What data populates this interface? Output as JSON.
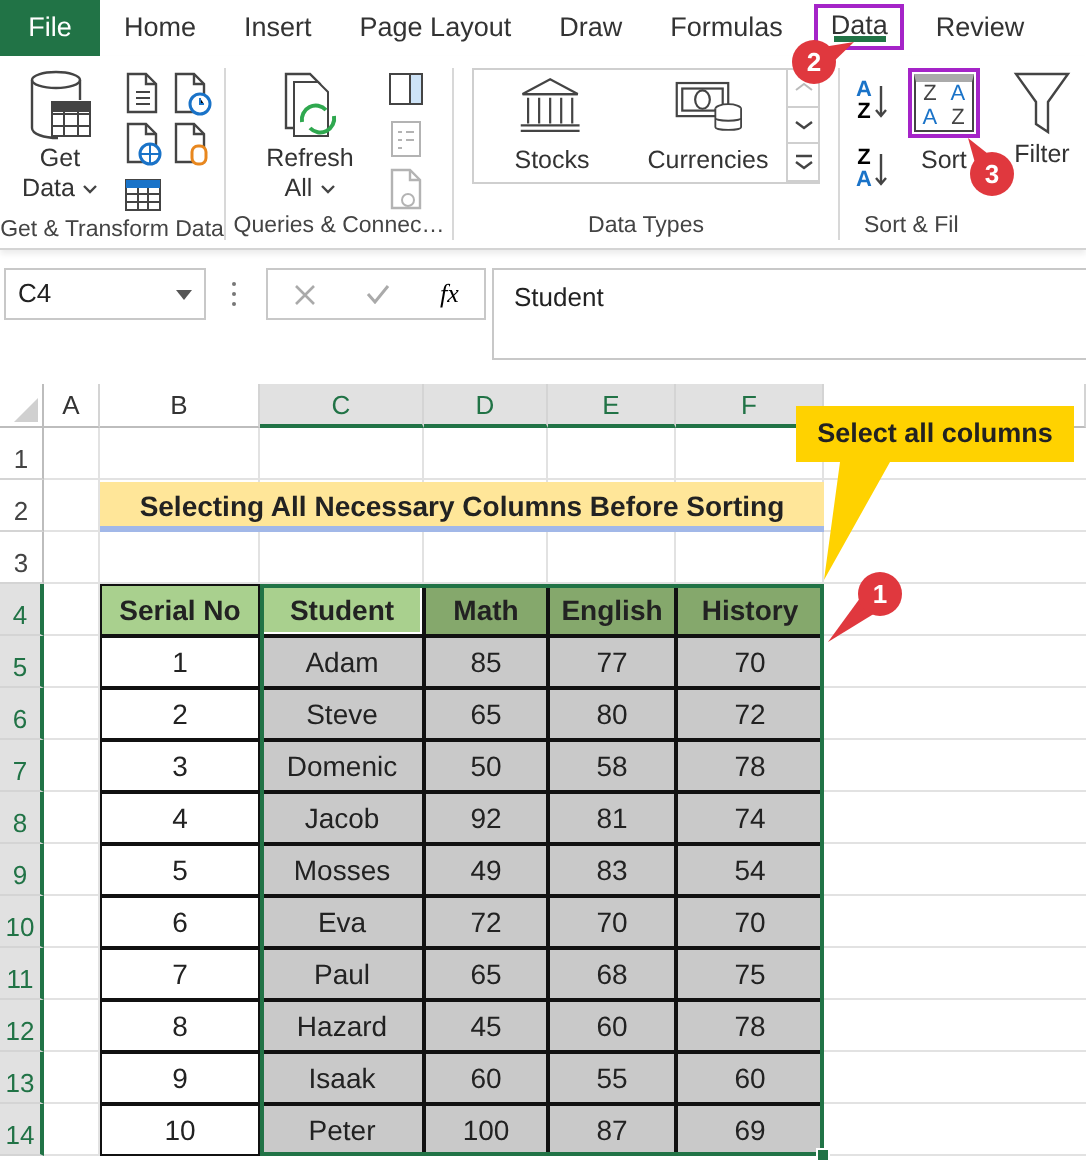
{
  "ribbon_tabs": [
    {
      "label": "File",
      "kind": "file",
      "selected": false,
      "highlighted": false
    },
    {
      "label": "Home",
      "kind": "tab",
      "selected": false,
      "highlighted": false
    },
    {
      "label": "Insert",
      "kind": "tab",
      "selected": false,
      "highlighted": false
    },
    {
      "label": "Page Layout",
      "kind": "tab",
      "selected": false,
      "highlighted": false
    },
    {
      "label": "Draw",
      "kind": "tab",
      "selected": false,
      "highlighted": false
    },
    {
      "label": "Formulas",
      "kind": "tab",
      "selected": false,
      "highlighted": false
    },
    {
      "label": "Data",
      "kind": "tab",
      "selected": true,
      "highlighted": true
    },
    {
      "label": "Review",
      "kind": "tab",
      "selected": false,
      "highlighted": false
    }
  ],
  "ribbon_groups": [
    {
      "label": "Get & Transform Data",
      "button": {
        "label": "Get Data",
        "has_menu": true
      }
    },
    {
      "label": "Queries & Connec…",
      "button": {
        "label": "Refresh All",
        "has_menu": true
      },
      "small_buttons": [
        {
          "disabled": false
        },
        {
          "disabled": true
        },
        {
          "disabled": true
        }
      ]
    },
    {
      "label": "Data Types",
      "gallery": [
        "Stocks",
        "Currencies"
      ]
    },
    {
      "label": "Sort & Fil",
      "sort_small": [
        {
          "upper": "A",
          "lower": "Z"
        },
        {
          "upper": "Z",
          "lower": "A"
        }
      ],
      "sort_button": {
        "label": "Sort",
        "highlighted": true,
        "icon_letters": [
          "Z",
          "A",
          "A",
          "Z"
        ]
      },
      "filter_button": {
        "label": "Filter"
      }
    }
  ],
  "formula_bar": {
    "name_box": "C4",
    "insert_function": "fx",
    "value": "Student"
  },
  "sheet": {
    "columns": [
      {
        "label": "A",
        "selected": false
      },
      {
        "label": "B",
        "selected": false
      },
      {
        "label": "C",
        "selected": true
      },
      {
        "label": "D",
        "selected": true
      },
      {
        "label": "E",
        "selected": true
      },
      {
        "label": "F",
        "selected": true
      }
    ],
    "rows": [
      {
        "label": "1",
        "selected": false
      },
      {
        "label": "2",
        "selected": false
      },
      {
        "label": "3",
        "selected": false
      },
      {
        "label": "4",
        "selected": true
      },
      {
        "label": "5",
        "selected": true
      },
      {
        "label": "6",
        "selected": true
      },
      {
        "label": "7",
        "selected": true
      },
      {
        "label": "8",
        "selected": true
      },
      {
        "label": "9",
        "selected": true
      },
      {
        "label": "10",
        "selected": true
      },
      {
        "label": "11",
        "selected": true
      },
      {
        "label": "12",
        "selected": true
      },
      {
        "label": "13",
        "selected": true
      },
      {
        "label": "14",
        "selected": true
      }
    ],
    "title": "Selecting All Necessary Columns Before Sorting",
    "table": {
      "columns": [
        {
          "label": "Serial No",
          "selected": false,
          "active": false
        },
        {
          "label": "Student",
          "selected": true,
          "active": true
        },
        {
          "label": "Math",
          "selected": true,
          "active": false
        },
        {
          "label": "English",
          "selected": true,
          "active": false
        },
        {
          "label": "History",
          "selected": true,
          "active": false
        }
      ],
      "rows": [
        [
          "1",
          "Adam",
          "85",
          "77",
          "70"
        ],
        [
          "2",
          "Steve",
          "65",
          "80",
          "72"
        ],
        [
          "3",
          "Domenic",
          "50",
          "58",
          "78"
        ],
        [
          "4",
          "Jacob",
          "92",
          "81",
          "74"
        ],
        [
          "5",
          "Mosses",
          "49",
          "83",
          "54"
        ],
        [
          "6",
          "Eva",
          "72",
          "70",
          "70"
        ],
        [
          "7",
          "Paul",
          "65",
          "68",
          "75"
        ],
        [
          "8",
          "Hazard",
          "45",
          "60",
          "78"
        ],
        [
          "9",
          "Isaak",
          "60",
          "55",
          "60"
        ],
        [
          "10",
          "Peter",
          "100",
          "87",
          "69"
        ]
      ]
    }
  },
  "callout": {
    "text": "Select all columns"
  },
  "step_badges": [
    "1",
    "2",
    "3"
  ]
}
